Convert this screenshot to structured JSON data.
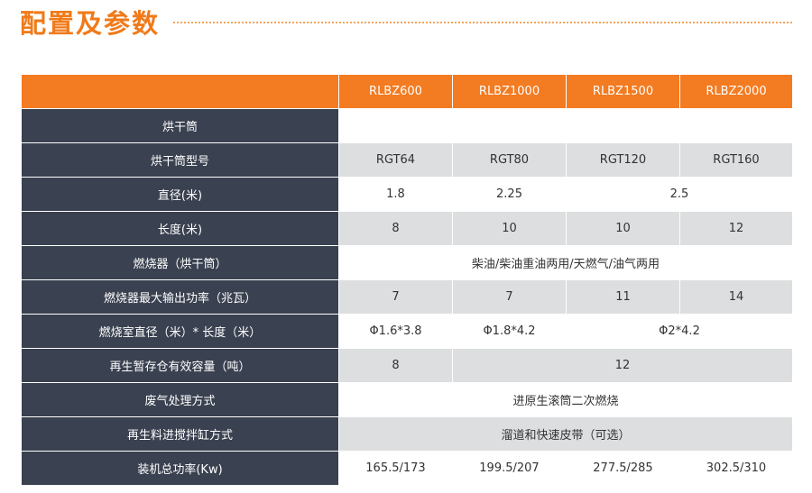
{
  "page": {
    "title": "配置及参数"
  },
  "table": {
    "columns": [
      "RLBZ600",
      "RLBZ1000",
      "RLBZ1500",
      "RLBZ2000"
    ],
    "rows": [
      {
        "label": "烘干筒",
        "cells": [
          {
            "text": "",
            "span": 4
          }
        ]
      },
      {
        "label": "烘干筒型号",
        "cells": [
          {
            "text": "RGT64",
            "span": 1
          },
          {
            "text": "RGT80",
            "span": 1
          },
          {
            "text": "RGT120",
            "span": 1
          },
          {
            "text": "RGT160",
            "span": 1
          }
        ]
      },
      {
        "label": "直径(米)",
        "cells": [
          {
            "text": "1.8",
            "span": 1
          },
          {
            "text": "2.25",
            "span": 1
          },
          {
            "text": "2.5",
            "span": 2
          }
        ]
      },
      {
        "label": "长度(米)",
        "cells": [
          {
            "text": "8",
            "span": 1
          },
          {
            "text": "10",
            "span": 1
          },
          {
            "text": "10",
            "span": 1
          },
          {
            "text": "12",
            "span": 1
          }
        ]
      },
      {
        "label": "燃烧器（烘干筒）",
        "cells": [
          {
            "text": "柴油/柴油重油两用/天燃气/油气两用",
            "span": 4
          }
        ]
      },
      {
        "label": "燃烧器最大输出功率（兆瓦）",
        "cells": [
          {
            "text": "7",
            "span": 1
          },
          {
            "text": "7",
            "span": 1
          },
          {
            "text": "11",
            "span": 1
          },
          {
            "text": "14",
            "span": 1
          }
        ]
      },
      {
        "label": "燃烧室直径（米）* 长度（米）",
        "cells": [
          {
            "text": "Φ1.6*3.8",
            "span": 1
          },
          {
            "text": "Φ1.8*4.2",
            "span": 1
          },
          {
            "text": "Φ2*4.2",
            "span": 2
          }
        ]
      },
      {
        "label": "再生暂存仓有效容量（吨）",
        "cells": [
          {
            "text": "8",
            "span": 1
          },
          {
            "text": "12",
            "span": 3
          }
        ]
      },
      {
        "label": "废气处理方式",
        "cells": [
          {
            "text": "进原生滚筒二次燃烧",
            "span": 4
          }
        ]
      },
      {
        "label": "再生料进搅拌缸方式",
        "cells": [
          {
            "text": "溜道和快速皮带（可选）",
            "span": 4
          }
        ]
      },
      {
        "label": "装机总功率(Kw)",
        "cells": [
          {
            "text": "165.5/173",
            "span": 1
          },
          {
            "text": "199.5/207",
            "span": 1
          },
          {
            "text": "277.5/285",
            "span": 1
          },
          {
            "text": "302.5/310",
            "span": 1
          }
        ]
      }
    ]
  }
}
